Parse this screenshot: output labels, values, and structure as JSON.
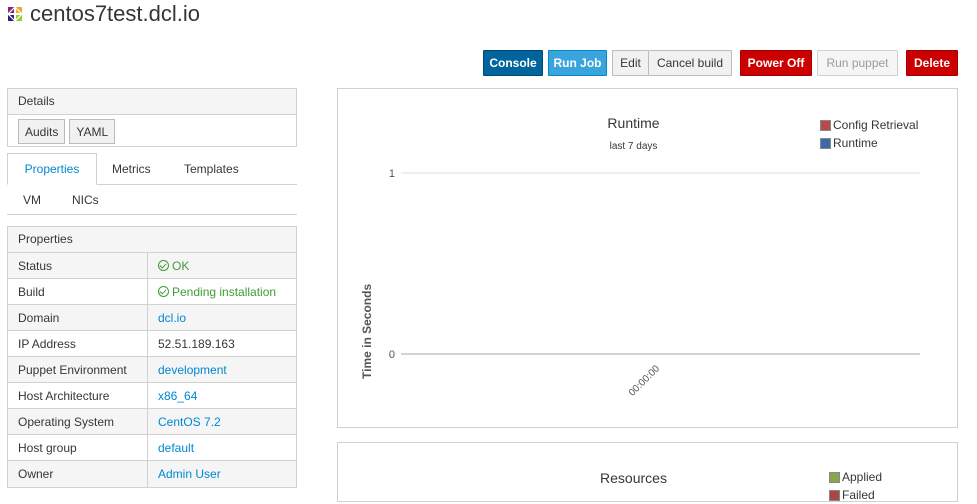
{
  "header": {
    "host_name": "centos7test.dcl.io"
  },
  "toolbar": {
    "console": "Console",
    "run_job": "Run Job",
    "edit": "Edit",
    "cancel_build": "Cancel build",
    "power_off": "Power Off",
    "run_puppet": "Run puppet",
    "delete": "Delete"
  },
  "details": {
    "title": "Details",
    "audits": "Audits",
    "yaml": "YAML"
  },
  "tabs": {
    "properties": "Properties",
    "metrics": "Metrics",
    "templates": "Templates",
    "vm": "VM",
    "nics": "NICs"
  },
  "properties": {
    "title": "Properties",
    "rows": [
      {
        "key": "Status",
        "value": "OK",
        "style": "ok"
      },
      {
        "key": "Build",
        "value": "Pending installation",
        "style": "ok"
      },
      {
        "key": "Domain",
        "value": "dcl.io",
        "style": "link"
      },
      {
        "key": "IP Address",
        "value": "52.51.189.163",
        "style": "plain"
      },
      {
        "key": "Puppet Environment",
        "value": "development",
        "style": "link"
      },
      {
        "key": "Host Architecture",
        "value": "x86_64",
        "style": "link"
      },
      {
        "key": "Operating System",
        "value": "CentOS 7.2",
        "style": "link"
      },
      {
        "key": "Host group",
        "value": "default",
        "style": "link"
      },
      {
        "key": "Owner",
        "value": "Admin User",
        "style": "link"
      }
    ]
  },
  "runtime_chart": {
    "title": "Runtime",
    "subtitle": "last 7 days",
    "ylabel": "Time in Seconds",
    "legend": [
      {
        "name": "Config Retrieval",
        "color": "#b94a48"
      },
      {
        "name": "Runtime",
        "color": "#3d6aab"
      }
    ]
  },
  "chart_data": {
    "type": "line",
    "title": "Runtime",
    "subtitle": "last 7 days",
    "xlabel": "",
    "ylabel": "Time in Seconds",
    "ylim": [
      0,
      1
    ],
    "yticks": [
      "1",
      "0"
    ],
    "x": [
      "00:00:00"
    ],
    "series": [
      {
        "name": "Config Retrieval",
        "values": []
      },
      {
        "name": "Runtime",
        "values": []
      }
    ],
    "grid": true,
    "legend_position": "top-right"
  },
  "resources_chart": {
    "title": "Resources",
    "legend": [
      {
        "name": "Applied",
        "color": "#89a54e"
      },
      {
        "name": "Failed",
        "color": "#aa4643"
      }
    ]
  }
}
